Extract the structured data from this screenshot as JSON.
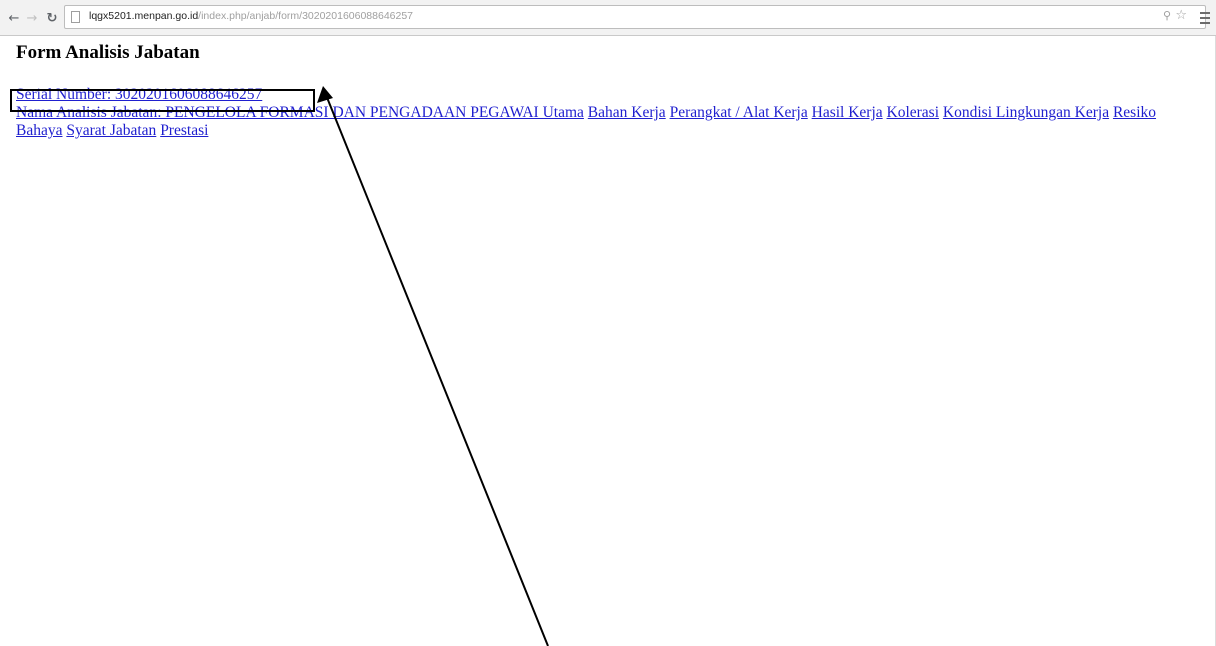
{
  "browser": {
    "url_host": "lqgx5201.menpan.go.id",
    "url_path": "/index.php/anjab/form/3020201606088646257"
  },
  "page": {
    "title": "Form Analisis Jabatan",
    "links": [
      "Serial Number: 3020201606088646257",
      "Nama Analisis Jabatan: PENGELOLA FORMASI DAN PENGADAAN PEGAWAI Utama",
      "Bahan Kerja",
      "Perangkat / Alat Kerja",
      "Hasil Kerja",
      "Kolerasi",
      "Kondisi Lingkungan Kerja",
      "Resiko Bahaya",
      "Syarat Jabatan",
      "Prestasi"
    ]
  },
  "icons": {
    "back": "back-arrow-icon",
    "forward": "forward-arrow-icon",
    "reload": "reload-icon",
    "page": "page-icon",
    "zoom": "zoom-icon",
    "star": "star-icon",
    "menu": "menu-icon"
  }
}
